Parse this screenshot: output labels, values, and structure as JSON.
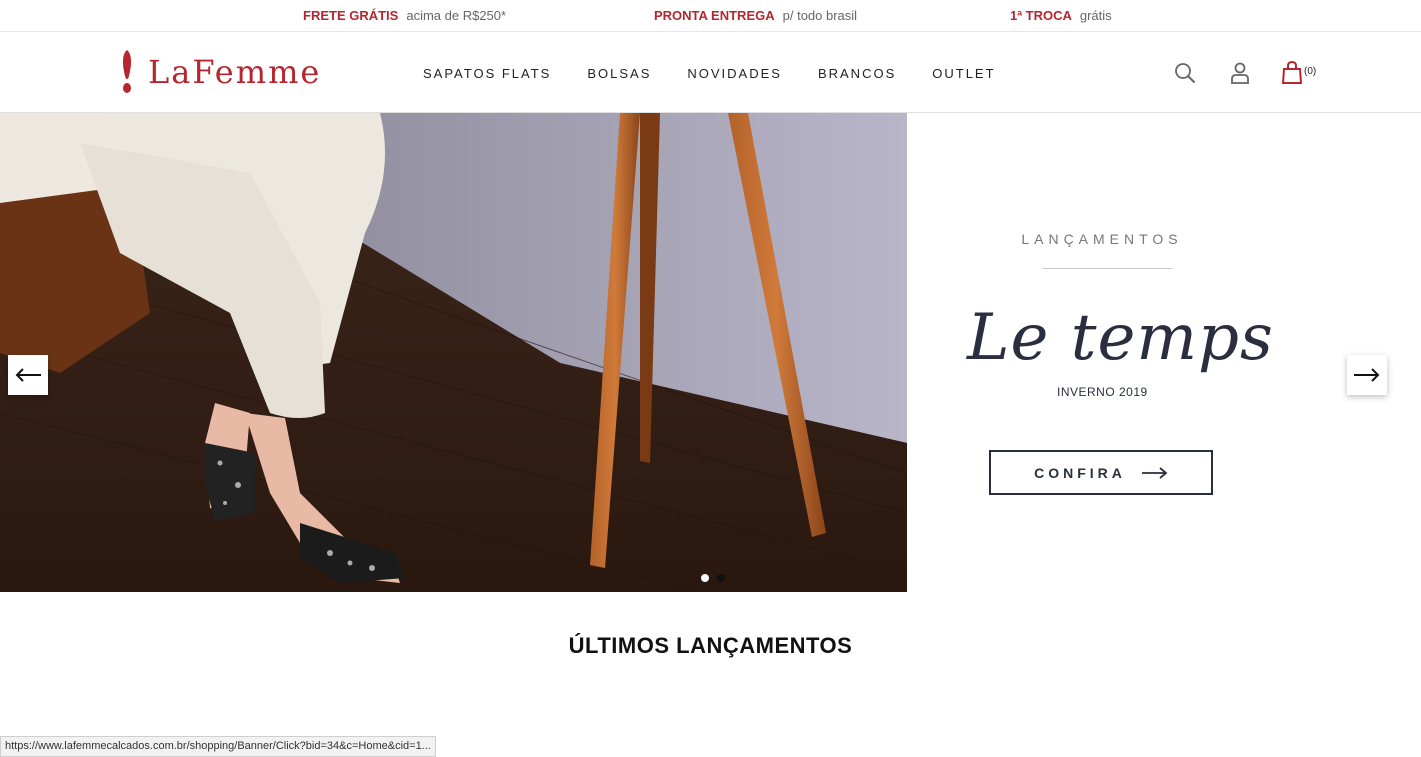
{
  "promo_bar": {
    "items": [
      {
        "highlight": "FRETE GRÁTIS",
        "text": "acima de R$250*"
      },
      {
        "highlight": "PRONTA ENTREGA",
        "text": "p/ todo brasil"
      },
      {
        "highlight": "1ª TROCA",
        "text": "grátis"
      }
    ]
  },
  "header": {
    "logo_text": "LaFemme",
    "nav": [
      "SAPATOS FLATS",
      "BOLSAS",
      "NOVIDADES",
      "BRANCOS",
      "OUTLET"
    ],
    "cart_count": "(0)",
    "icons": {
      "search": "search-icon",
      "user": "user-icon",
      "cart": "shopping-bag-icon"
    }
  },
  "hero": {
    "launch_label": "LANÇAMENTOS",
    "collection_title": "Le temps",
    "season": "INVERNO 2019",
    "cta_label": "CONFIRA",
    "slides": 2,
    "active_slide": 1
  },
  "section": {
    "title": "ÚLTIMOS LANÇAMENTOS"
  },
  "status_bar": {
    "url": "https://www.lafemmecalcados.com.br/shopping/Banner/Click?bid=34&c=Home&cid=1..."
  },
  "colors": {
    "brand": "#b5262e",
    "text_dark": "#2a2e3e"
  }
}
